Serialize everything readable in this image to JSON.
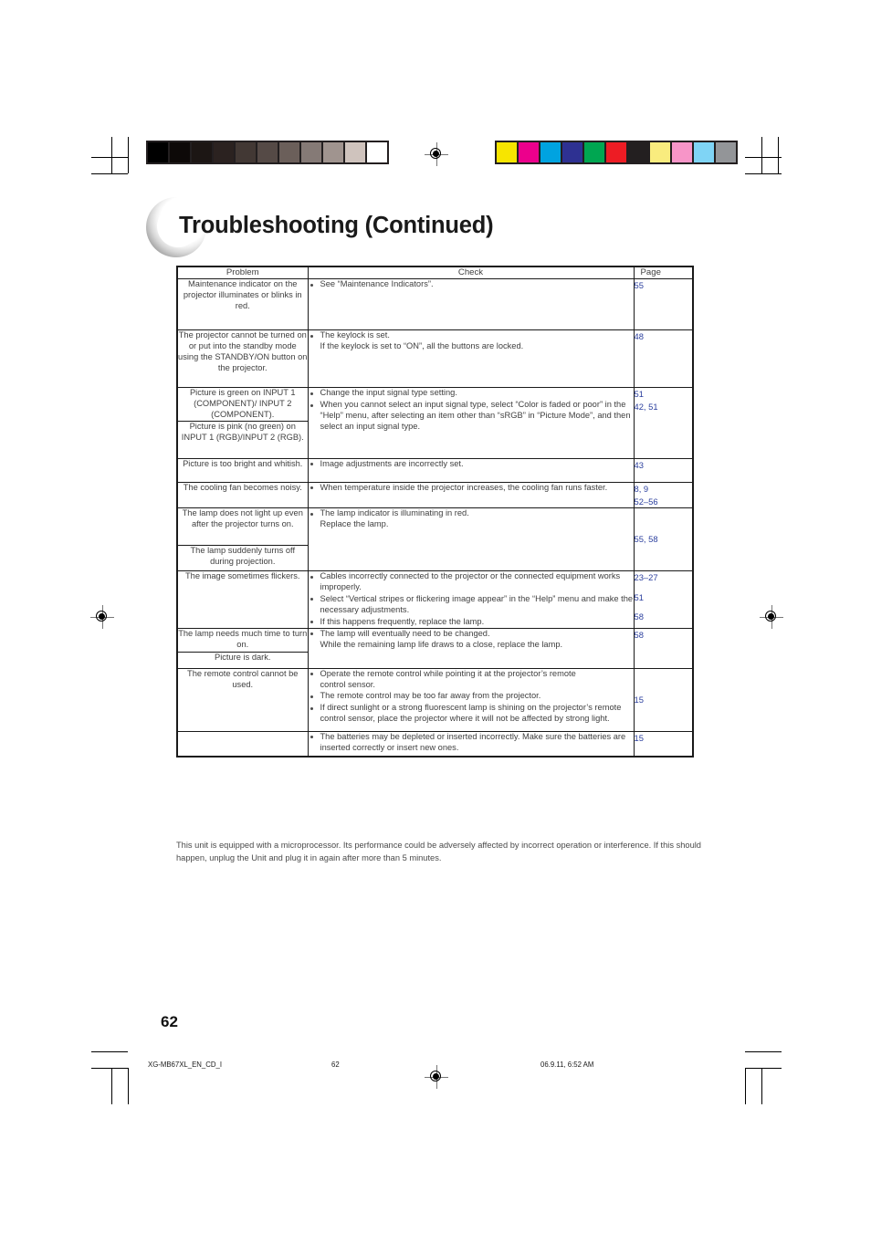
{
  "document": {
    "title": "Troubleshooting (Continued)",
    "folio": "62",
    "footnote": "This unit is equipped with a microprocessor. Its performance could be adversely affected by incorrect operation or interference. If this should happen, unplug the Unit and plug it in again after more than 5 minutes.",
    "slug": {
      "file": "XG-MB67XL_EN_CD_I",
      "page": "62",
      "timestamp": "06.9.11, 6:52 AM"
    }
  },
  "table": {
    "headers": {
      "problem": "Problem",
      "check": "Check",
      "page": "Page"
    },
    "problems": [
      {
        "text": "Maintenance indicator on the projector illuminates or blinks in red."
      },
      {
        "text": "The projector cannot be turned on or put into the standby mode using the STANDBY/ON button on the projector."
      },
      {
        "text": "Picture is green on INPUT 1 (COMPONENT)/ INPUT 2 (COMPONENT)."
      },
      {
        "text": "Picture is pink (no green) on INPUT 1 (RGB)/INPUT 2 (RGB)."
      },
      {
        "text": "Picture is too bright and whitish."
      },
      {
        "text": "The cooling fan becomes noisy."
      },
      {
        "text": "The lamp does not light up even after the projector turns on."
      },
      {
        "text": "The lamp suddenly turns off during projection."
      },
      {
        "text": "The image sometimes flickers."
      },
      {
        "text": "The lamp needs much time to turn on."
      },
      {
        "text": "Picture is dark."
      },
      {
        "text": "The remote control cannot be used."
      },
      {
        "text": ""
      }
    ],
    "checks": {
      "maintenance_indicator": "See “Maintenance Indicators”.",
      "keylock_1": "The keylock is set.",
      "keylock_2": "If the keylock is set to “ON”, all the buttons are locked.",
      "signal_1": "Change the input signal type setting.",
      "signal_2": "When you cannot select an input signal type, select “Color is faded or poor” in the “Help” menu, after selecting an item other than “sRGB” in “Picture Mode”, and then select an input signal type.",
      "bright": "Image adjustments are incorrectly set.",
      "fan": "When temperature inside the projector increases, the cooling fan runs faster.",
      "lamp_1": "The lamp indicator is illuminating in red.",
      "lamp_2": "Replace the lamp.",
      "flicker_1": "Cables incorrectly connected to the projector or the connected equipment works improperly.",
      "flicker_2": "Select “Vertical stripes or flickering image appear” in the “Help” menu and make the necessary adjustments.",
      "flicker_3": "If this happens frequently, replace the lamp.",
      "lamptime_1": "The lamp will eventually need to be changed.",
      "lamptime_2": "While the remaining lamp life draws to a close, replace the lamp.",
      "remote_1a": "Operate the remote control while pointing it at the projector’s remote",
      "remote_1b": "control sensor.",
      "remote_2": "The remote control may be too far away from the projector.",
      "remote_3": "If direct sunlight or a strong fluorescent lamp is shining on the projector’s remote control sensor, place the projector where it will not be affected by strong light.",
      "batteries": "The batteries may be depleted or inserted incorrectly. Make sure the batteries are inserted correctly or insert new ones."
    },
    "pages": {
      "maintenance": "55",
      "keylock": "48",
      "signal_a": "51",
      "signal_b": "42, 51",
      "bright": "43",
      "fan_a": "8, 9",
      "fan_b": "52–56",
      "lamp": "55, 58",
      "flicker_a": "23–27",
      "flicker_b": "51",
      "flicker_c": "58",
      "lamptime": "58",
      "remote": "15",
      "batteries": "15"
    }
  },
  "calibration": {
    "grayscale": [
      "#000000",
      "#0d0908",
      "#1c1614",
      "#2b2220",
      "#423834",
      "#554a46",
      "#6b5f5a",
      "#857a76",
      "#a0948f",
      "#cfc3bd",
      "#ffffff"
    ],
    "colors": [
      "#f7e500",
      "#ec008c",
      "#00a3e0",
      "#2e3192",
      "#00a651",
      "#ed1c24",
      "#231f20",
      "#f9ec7e",
      "#f795c8",
      "#7fd4f5",
      "#939598"
    ]
  }
}
